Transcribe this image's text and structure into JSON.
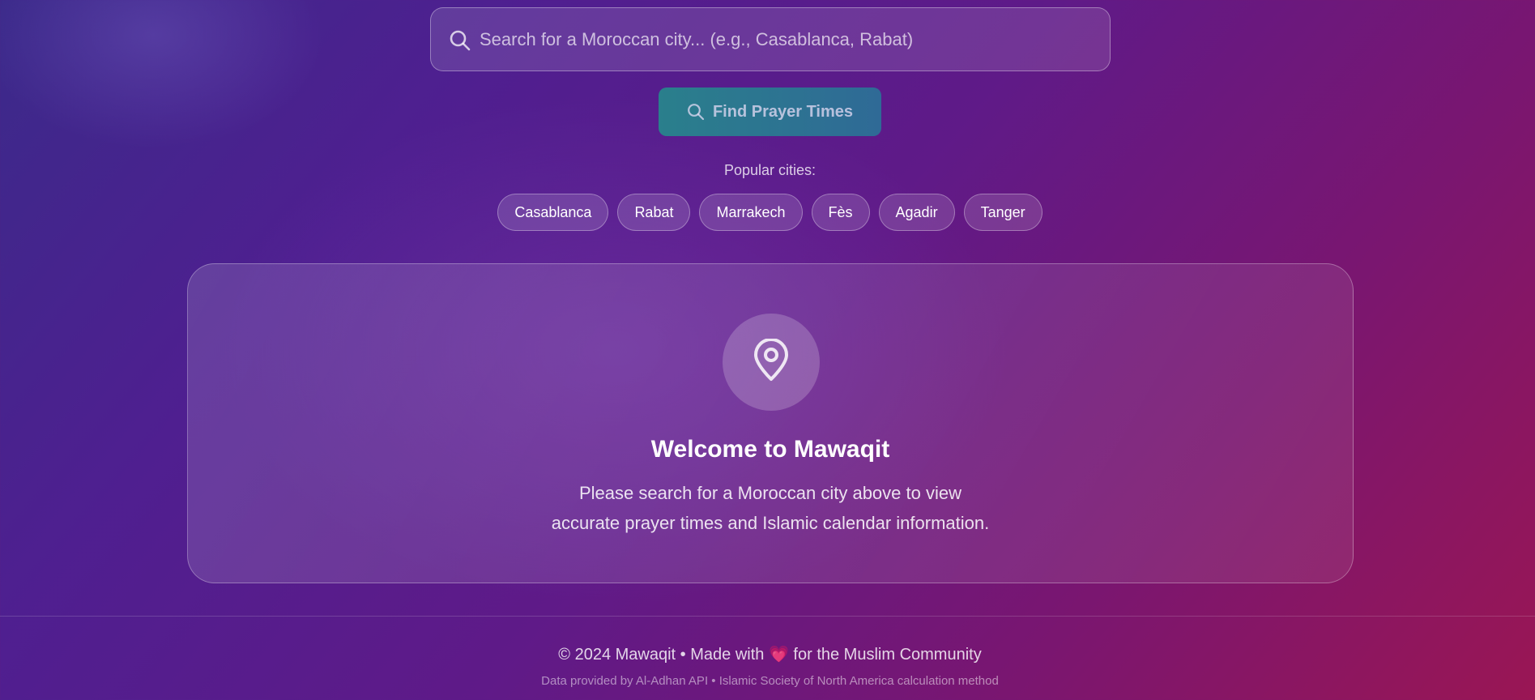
{
  "search": {
    "placeholder": "Search for a Moroccan city... (e.g., Casablanca, Rabat)",
    "button_label": "Find Prayer Times"
  },
  "popular": {
    "label": "Popular cities:",
    "cities": [
      "Casablanca",
      "Rabat",
      "Marrakech",
      "Fès",
      "Agadir",
      "Tanger"
    ]
  },
  "welcome": {
    "title": "Welcome to Mawaqit",
    "line1": "Please search for a Moroccan city above to view",
    "line2": "accurate prayer times and Islamic calendar information."
  },
  "footer": {
    "copyright": "© 2024 Mawaqit • Made with",
    "heart": "💗",
    "community": "for the Muslim Community",
    "data_source": "Data provided by Al-Adhan API • Islamic Society of North America calculation method"
  },
  "icons": {
    "search": "search-icon",
    "pin": "map-pin-icon",
    "heart": "heart-icon"
  },
  "colors": {
    "button_start": "#2a7f8c",
    "button_end": "#2f6a96",
    "heart": "#e0477a"
  }
}
